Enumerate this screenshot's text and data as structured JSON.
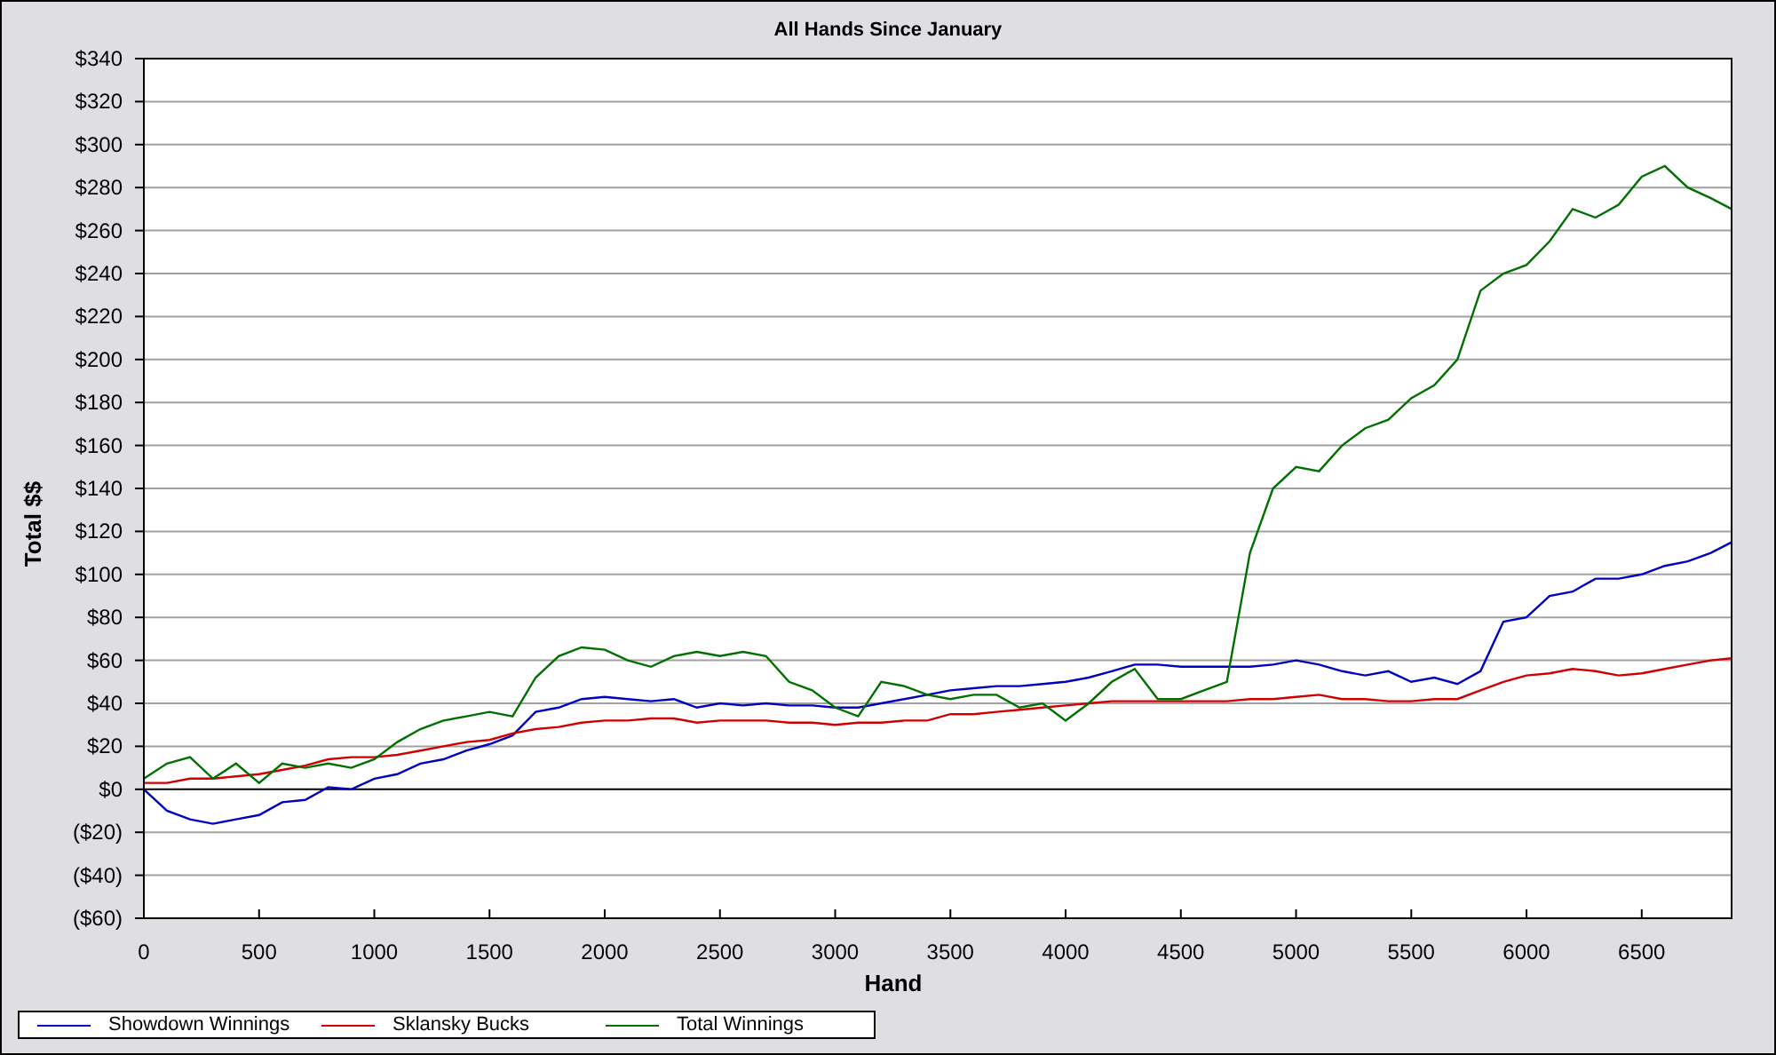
{
  "chart_data": {
    "type": "line",
    "title": "All Hands Since January",
    "xlabel": "Hand",
    "ylabel": "Total $$",
    "x": [
      0,
      100,
      200,
      300,
      400,
      500,
      600,
      700,
      800,
      900,
      1000,
      1100,
      1200,
      1300,
      1400,
      1500,
      1600,
      1700,
      1800,
      1900,
      2000,
      2100,
      2200,
      2300,
      2400,
      2500,
      2600,
      2700,
      2800,
      2900,
      3000,
      3100,
      3200,
      3300,
      3400,
      3500,
      3600,
      3700,
      3800,
      3900,
      4000,
      4100,
      4200,
      4300,
      4400,
      4500,
      4600,
      4700,
      4800,
      4900,
      5000,
      5100,
      5200,
      5300,
      5400,
      5500,
      5600,
      5700,
      5800,
      5900,
      6000,
      6100,
      6200,
      6300,
      6400,
      6500,
      6600,
      6700,
      6800,
      6890
    ],
    "series": [
      {
        "name": "Showdown Winnings",
        "color": "#0000c0",
        "values": [
          0,
          -10,
          -14,
          -16,
          -14,
          -12,
          -6,
          -5,
          1,
          0,
          5,
          7,
          12,
          14,
          18,
          21,
          25,
          36,
          38,
          42,
          43,
          42,
          41,
          42,
          38,
          40,
          39,
          40,
          39,
          39,
          38,
          38,
          40,
          42,
          44,
          46,
          47,
          48,
          48,
          49,
          50,
          52,
          55,
          58,
          58,
          57,
          57,
          57,
          57,
          58,
          60,
          58,
          55,
          53,
          55,
          50,
          52,
          49,
          55,
          78,
          80,
          90,
          92,
          98,
          98,
          100,
          104,
          106,
          110,
          115
        ]
      },
      {
        "name": "Sklansky Bucks",
        "color": "#d00000",
        "values": [
          3,
          3,
          5,
          5,
          6,
          7,
          9,
          11,
          14,
          15,
          15,
          16,
          18,
          20,
          22,
          23,
          26,
          28,
          29,
          31,
          32,
          32,
          33,
          33,
          31,
          32,
          32,
          32,
          31,
          31,
          30,
          31,
          31,
          32,
          32,
          35,
          35,
          36,
          37,
          38,
          39,
          40,
          41,
          41,
          41,
          41,
          41,
          41,
          42,
          42,
          43,
          44,
          42,
          42,
          41,
          41,
          42,
          42,
          46,
          50,
          53,
          54,
          56,
          55,
          53,
          54,
          56,
          58,
          60,
          61
        ]
      },
      {
        "name": "Total Winnings",
        "color": "#007000",
        "values": [
          5,
          12,
          15,
          5,
          12,
          3,
          12,
          10,
          12,
          10,
          14,
          22,
          28,
          32,
          34,
          36,
          34,
          52,
          62,
          66,
          65,
          60,
          57,
          62,
          64,
          62,
          64,
          62,
          50,
          46,
          38,
          34,
          50,
          48,
          44,
          42,
          44,
          44,
          38,
          40,
          32,
          40,
          50,
          56,
          42,
          42,
          46,
          50,
          110,
          140,
          150,
          148,
          160,
          168,
          172,
          182,
          188,
          200,
          232,
          240,
          244,
          255,
          270,
          266,
          272,
          285,
          290,
          280,
          275,
          270
        ]
      }
    ],
    "grid": true,
    "xlim": [
      0,
      6890
    ],
    "ylim": [
      -60,
      340
    ],
    "xticks": [
      0,
      500,
      1000,
      1500,
      2000,
      2500,
      3000,
      3500,
      4000,
      4500,
      5000,
      5500,
      6000,
      6500
    ],
    "yticks": [
      {
        "value": 340,
        "label": "$340"
      },
      {
        "value": 320,
        "label": "$320"
      },
      {
        "value": 300,
        "label": "$300"
      },
      {
        "value": 280,
        "label": "$280"
      },
      {
        "value": 260,
        "label": "$260"
      },
      {
        "value": 240,
        "label": "$240"
      },
      {
        "value": 220,
        "label": "$220"
      },
      {
        "value": 200,
        "label": "$200"
      },
      {
        "value": 180,
        "label": "$180"
      },
      {
        "value": 160,
        "label": "$160"
      },
      {
        "value": 140,
        "label": "$140"
      },
      {
        "value": 120,
        "label": "$120"
      },
      {
        "value": 100,
        "label": "$100"
      },
      {
        "value": 80,
        "label": "$80"
      },
      {
        "value": 60,
        "label": "$60"
      },
      {
        "value": 40,
        "label": "$40"
      },
      {
        "value": 20,
        "label": "$20"
      },
      {
        "value": 0,
        "label": "$0"
      },
      {
        "value": -20,
        "label": "($20)"
      },
      {
        "value": -40,
        "label": "($40)"
      },
      {
        "value": -60,
        "label": "($60)"
      }
    ]
  }
}
